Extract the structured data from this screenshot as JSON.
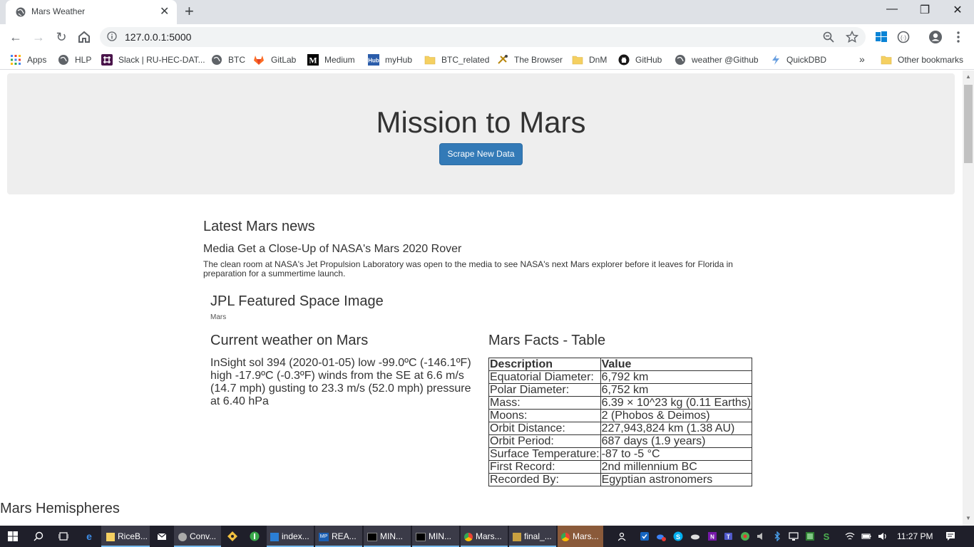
{
  "browser": {
    "tab_title": "Mars Weather",
    "tab_close": "✕",
    "new_tab": "+",
    "url": "127.0.0.1:5000",
    "window_controls": {
      "minimize": "—",
      "restore": "❐",
      "close": "✕"
    },
    "bookmarks": [
      {
        "label": "Apps",
        "icon": "apps-grid-icon"
      },
      {
        "label": "HLP",
        "icon": "globe-icon"
      },
      {
        "label": "Slack | RU-HEC-DAT...",
        "icon": "slack-icon"
      },
      {
        "label": "BTC",
        "icon": "globe-icon"
      },
      {
        "label": "GitLab",
        "icon": "gitlab-icon"
      },
      {
        "label": "Medium",
        "icon": "medium-icon"
      },
      {
        "label": "myHub",
        "icon": "hub-icon"
      },
      {
        "label": "BTC_related",
        "icon": "folder-icon"
      },
      {
        "label": "The Browser",
        "icon": "browser-icon"
      },
      {
        "label": "DnM",
        "icon": "folder-icon"
      },
      {
        "label": "GitHub",
        "icon": "github-icon"
      },
      {
        "label": "weather @Github",
        "icon": "globe-icon"
      },
      {
        "label": "QuickDBD",
        "icon": "quickdbd-icon"
      }
    ],
    "bookmarks_overflow": "»",
    "other_bookmarks": "Other bookmarks"
  },
  "page": {
    "title": "Mission to Mars",
    "scrape_button": "Scrape New Data",
    "news_heading": "Latest Mars news",
    "news_title": "Media Get a Close-Up of NASA's Mars 2020 Rover",
    "news_paragraph": "The clean room at NASA's Jet Propulsion Laboratory was open to the media to see NASA's next Mars explorer before it leaves for Florida in preparation for a summertime launch.",
    "jpl_heading": "JPL Featured Space Image",
    "jpl_image_alt": "Mars",
    "weather_heading": "Current weather on Mars",
    "weather_text": "InSight sol 394 (2020-01-05) low -99.0ºC (-146.1ºF) high -17.9ºC (-0.3ºF) winds from the SE at 6.6 m/s (14.7 mph) gusting to 23.3 m/s (52.0 mph) pressure at 6.40 hPa",
    "facts_heading": "Mars Facts - Table",
    "facts_table": {
      "headers": [
        "Description",
        "Value"
      ],
      "rows": [
        [
          "Equatorial Diameter:",
          "6,792 km"
        ],
        [
          "Polar Diameter:",
          "6,752 km"
        ],
        [
          "Mass:",
          "6.39 × 10^23 kg (0.11 Earths)"
        ],
        [
          "Moons:",
          "2 (Phobos & Deimos)"
        ],
        [
          "Orbit Distance:",
          "227,943,824 km (1.38 AU)"
        ],
        [
          "Orbit Period:",
          "687 days (1.9 years)"
        ],
        [
          "Surface Temperature:",
          "-87 to -5 °C"
        ],
        [
          "First Record:",
          "2nd millennium BC"
        ],
        [
          "Recorded By:",
          "Egyptian astronomers"
        ]
      ]
    },
    "hemispheres_heading": "Mars Hemispheres"
  },
  "taskbar": {
    "items": [
      {
        "label": "RiceB...",
        "icon": "folder-icon"
      },
      {
        "label": "",
        "icon": "mail-icon"
      },
      {
        "label": "Conv...",
        "icon": "chat-icon"
      },
      {
        "label": "",
        "icon": "git-icon"
      },
      {
        "label": "",
        "icon": "node-icon"
      },
      {
        "label": "index...",
        "icon": "vscode-icon"
      },
      {
        "label": "REA...",
        "icon": "markdown-icon"
      },
      {
        "label": "MIN...",
        "icon": "terminal-icon"
      },
      {
        "label": "MIN...",
        "icon": "terminal-icon"
      },
      {
        "label": "Mars...",
        "icon": "chrome-icon"
      },
      {
        "label": "final_...",
        "icon": "paint-icon"
      },
      {
        "label": "Mars...",
        "icon": "chrome-icon"
      }
    ],
    "clock": "11:27 PM"
  }
}
